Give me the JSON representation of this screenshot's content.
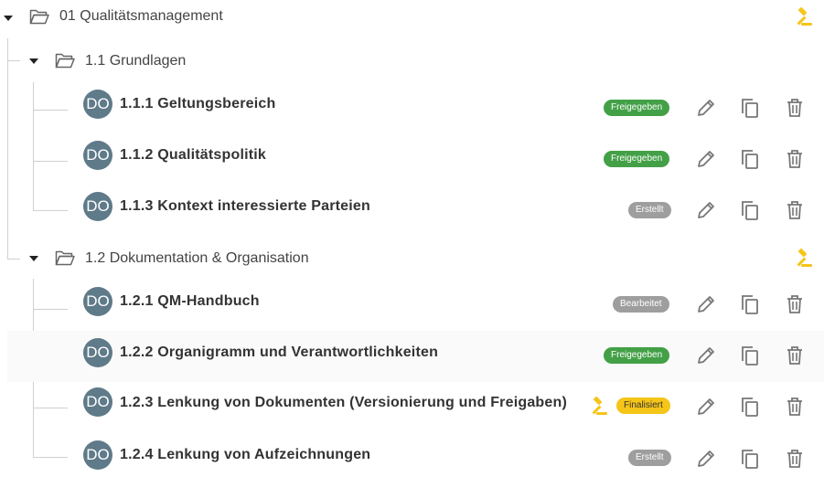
{
  "tree": {
    "root": {
      "label": "01 Qualitätsmanagement"
    },
    "groups": [
      {
        "label": "1.1 Grundlagen"
      },
      {
        "label": "1.2 Dokumentation & Organisation"
      }
    ],
    "documents": [
      {
        "initials": "DO",
        "title": "1.1.1 Geltungsbereich",
        "status": "Freigegeben"
      },
      {
        "initials": "DO",
        "title": "1.1.2 Qualitätspolitik",
        "status": "Freigegeben"
      },
      {
        "initials": "DO",
        "title": "1.1.3 Kontext interessierte Parteien",
        "status": "Erstellt"
      },
      {
        "initials": "DO",
        "title": "1.2.1 QM-Handbuch",
        "status": "Bearbeitet"
      },
      {
        "initials": "DO",
        "title": "1.2.2 Organigramm und Verantwortlichkeiten",
        "status": "Freigegeben"
      },
      {
        "initials": "DO",
        "title": "1.2.3 Lenkung von Dokumenten (Versionierung und Freigaben)",
        "status": "Finalisiert"
      },
      {
        "initials": "DO",
        "title": "1.2.4 Lenkung von Aufzeichnungen",
        "status": "Erstellt"
      }
    ]
  },
  "status_colors": {
    "Freigegeben": "#43a047",
    "Erstellt": "#9e9e9e",
    "Bearbeitet": "#9e9e9e",
    "Finalisiert": "#f5c518"
  },
  "icons": {
    "toggle": "caret-down-icon",
    "folder": "folder-open-icon",
    "approve": "gavel-icon",
    "edit": "pencil-icon",
    "copy": "copy-icon",
    "delete": "trash-icon"
  }
}
